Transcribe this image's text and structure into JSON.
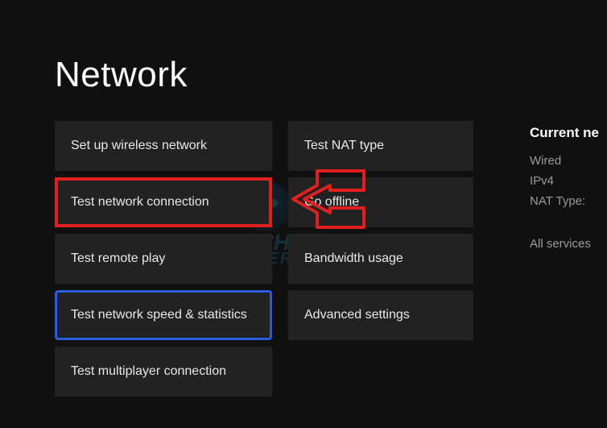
{
  "page": {
    "title": "Network"
  },
  "leftMenu": {
    "items": [
      {
        "label": "Set up wireless network"
      },
      {
        "label": "Test network connection"
      },
      {
        "label": "Test remote play"
      },
      {
        "label": "Test network speed & statistics"
      },
      {
        "label": "Test multiplayer connection"
      }
    ]
  },
  "rightMenu": {
    "items": [
      {
        "label": "Test NAT type"
      },
      {
        "label": "Go offline"
      },
      {
        "label": "Bandwidth usage"
      },
      {
        "label": "Advanced settings"
      }
    ]
  },
  "info": {
    "heading": "Current ne",
    "lines": [
      "Wired",
      "IPv4",
      "NAT Type:"
    ],
    "services": "All services"
  },
  "watermark": {
    "line1": "TECH4",
    "line2": "GAMERS"
  },
  "annotations": {
    "highlighted_red_item": "Test network connection",
    "highlighted_blue_item": "Test network speed & statistics",
    "arrow_color": "#e21f1f"
  }
}
